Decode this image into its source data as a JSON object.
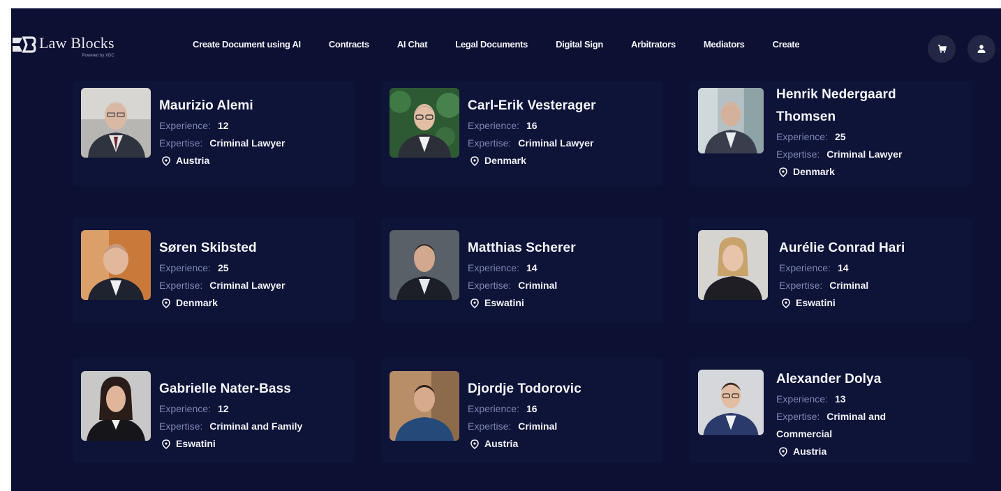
{
  "brand": {
    "name": "Law Blocks",
    "tagline": "Powered by XDC"
  },
  "nav": {
    "links": [
      "Create Document using AI",
      "Contracts",
      "AI Chat",
      "Legal Documents",
      "Digital Sign",
      "Arbitrators",
      "Mediators",
      "Create"
    ],
    "cart_icon": "cart-icon",
    "user_icon": "user-icon"
  },
  "labels": {
    "experience": "Experience:",
    "expertise": "Expertise:"
  },
  "lawyers": [
    {
      "name": "Maurizio Alemi",
      "experience": "12",
      "expertise": "Criminal Lawyer",
      "location": "Austria"
    },
    {
      "name": "Carl-Erik Vesterager",
      "experience": "16",
      "expertise": "Criminal Lawyer",
      "location": "Denmark"
    },
    {
      "name": "Henrik Nedergaard Thomsen",
      "experience": "25",
      "expertise": "Criminal Lawyer",
      "location": "Denmark"
    },
    {
      "name": "Søren Skibsted",
      "experience": "25",
      "expertise": "Criminal Lawyer",
      "location": "Denmark"
    },
    {
      "name": "Matthias Scherer",
      "experience": "14",
      "expertise": "Criminal",
      "location": "Eswatini"
    },
    {
      "name": "Aurélie Conrad Hari",
      "experience": "14",
      "expertise": "Criminal",
      "location": "Eswatini"
    },
    {
      "name": "Gabrielle Nater-Bass",
      "experience": "12",
      "expertise": "Criminal and Family",
      "location": "Eswatini"
    },
    {
      "name": "Djordje Todorovic",
      "experience": "16",
      "expertise": "Criminal",
      "location": "Austria"
    },
    {
      "name": "Alexander Dolya",
      "experience": "13",
      "expertise": "Criminal and Commercial",
      "location": "Austria"
    }
  ],
  "colors": {
    "background": "#0c1033",
    "card": "#0e1338",
    "label": "#7e86b3",
    "text": "#f1f2f7"
  }
}
